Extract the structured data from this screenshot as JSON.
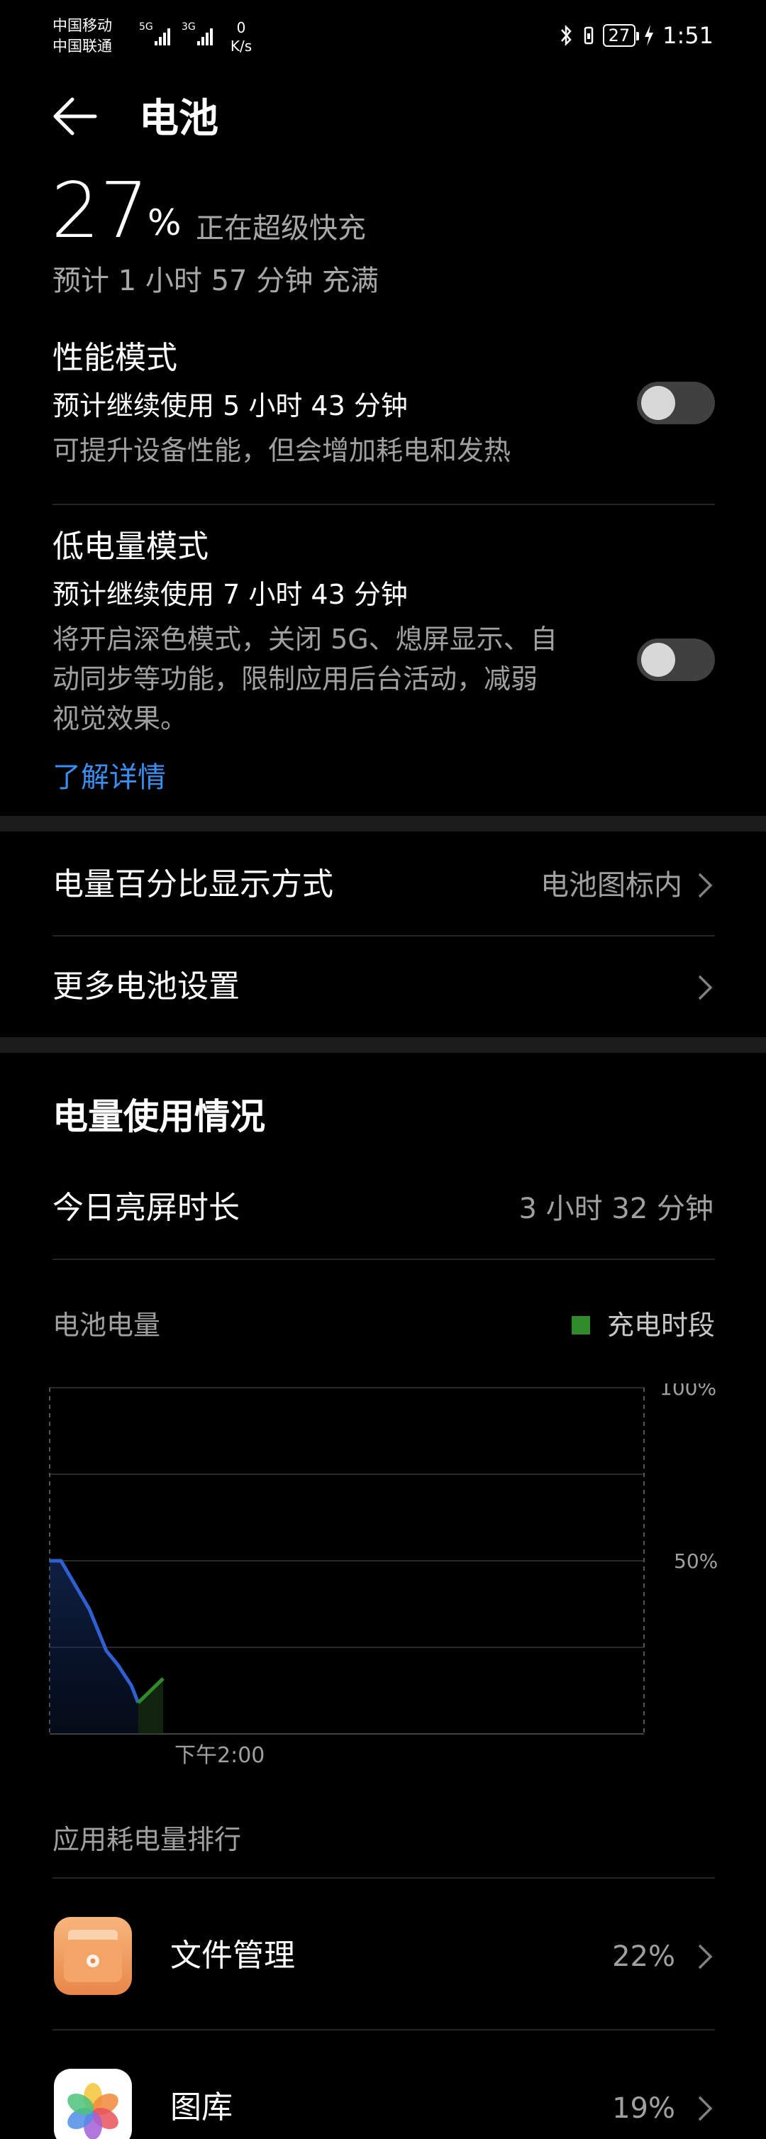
{
  "status_bar": {
    "carrier_1": "中国移动",
    "carrier_2": "中国联通",
    "net_speed_value": "0",
    "net_speed_unit": "K/s",
    "battery_level": "27",
    "time": "1:51"
  },
  "header": {
    "title": "电池"
  },
  "battery": {
    "percent": "27",
    "percent_sign": "%",
    "status": "正在超级快充",
    "eta": "预计 1 小时 57 分钟 充满"
  },
  "performance_mode": {
    "title": "性能模式",
    "estimate": "预计继续使用 5 小时 43 分钟",
    "description": "可提升设备性能，但会增加耗电和发热",
    "enabled": false
  },
  "low_power_mode": {
    "title": "低电量模式",
    "estimate": "预计继续使用 7 小时 43 分钟",
    "description_line_1": "将开启深色模式，关闭 5G、熄屏显示、自",
    "description_line_2": "动同步等功能，限制应用后台活动，减弱",
    "description_line_3": "视觉效果。",
    "enabled": false,
    "link": "了解详情"
  },
  "settings": {
    "percent_display_label": "电量百分比显示方式",
    "percent_display_value": "电池图标内",
    "more_settings_label": "更多电池设置"
  },
  "usage": {
    "section_title": "电量使用情况",
    "screen_on_label": "今日亮屏时长",
    "screen_on_value": "3 小时 32 分钟",
    "chart_label": "电池电量",
    "legend_label": "充电时段",
    "charging_color": "#2f8a2a",
    "line_color": "#2f5fd0"
  },
  "chart_data": {
    "type": "area",
    "y_tick_labels": [
      "100%",
      "50%"
    ],
    "x_tick_labels": [
      "下午2:00"
    ],
    "ylim": [
      0,
      100
    ],
    "grid": true,
    "series": [
      {
        "values": [
          {
            "t": 0,
            "y": 50
          },
          {
            "t": 0.1,
            "y": 50
          },
          {
            "t": 0.35,
            "y": 36
          },
          {
            "t": 0.5,
            "y": 24
          },
          {
            "t": 0.6,
            "y": 20
          },
          {
            "t": 0.72,
            "y": 14
          },
          {
            "t": 0.78,
            "y": 9
          }
        ]
      },
      {
        "charging": true,
        "values": [
          {
            "t": 0.78,
            "y": 9
          },
          {
            "t": 1.0,
            "y": 16
          }
        ]
      }
    ]
  },
  "app_ranking": {
    "title": "应用耗电量排行",
    "apps": [
      {
        "name": "文件管理",
        "percent": "22%",
        "icon": "file-manager-icon"
      },
      {
        "name": "图库",
        "percent": "19%",
        "icon": "gallery-icon"
      }
    ]
  }
}
